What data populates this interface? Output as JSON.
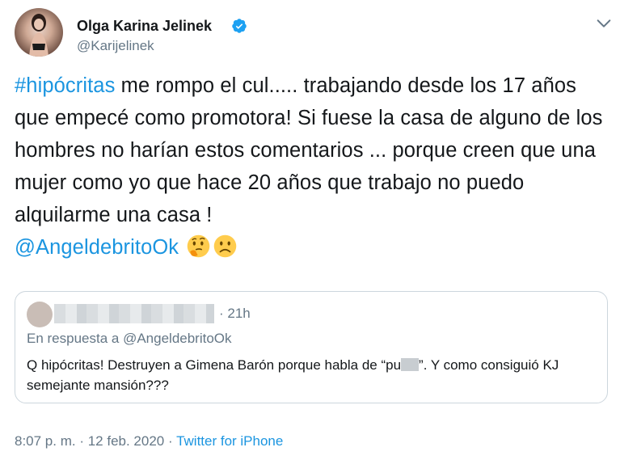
{
  "author": {
    "name": "Olga Karina Jelinek",
    "handle": "@Karijelinek",
    "verified": true
  },
  "tweet": {
    "hashtag": "#hipócritas",
    "text": " me rompo el cul..... trabajando desde los 17 años que empecé como promotora! Si fuese la casa de alguno de los hombres no harían estos comentarios ... porque creen que una mujer como yo que hace 20 años que trabajo no puedo alquilarme una casa !",
    "mention": "@AngeldebritoOk",
    "emojis": [
      "thinking-face-emoji",
      "slightly-frowning-face-emoji"
    ]
  },
  "quoted": {
    "time": "· 21h",
    "reply_prefix": "En respuesta a ",
    "reply_to": "@AngeldebritoOk",
    "text_part1": "Q hipócritas! Destruyen a Gimena Barón porque habla de “pu",
    "text_part2": "”. Y como consiguió KJ semejante mansión???"
  },
  "meta": {
    "time": "8:07 p. m.",
    "separator1": " · ",
    "date": "12 feb. 2020",
    "separator2": " · ",
    "source": "Twitter for iPhone"
  },
  "colors": {
    "link": "#1b95e0",
    "secondary_text": "#657786",
    "primary_text": "#14171a",
    "verified_badge": "#1da1f2",
    "border": "#ccd6dd"
  }
}
